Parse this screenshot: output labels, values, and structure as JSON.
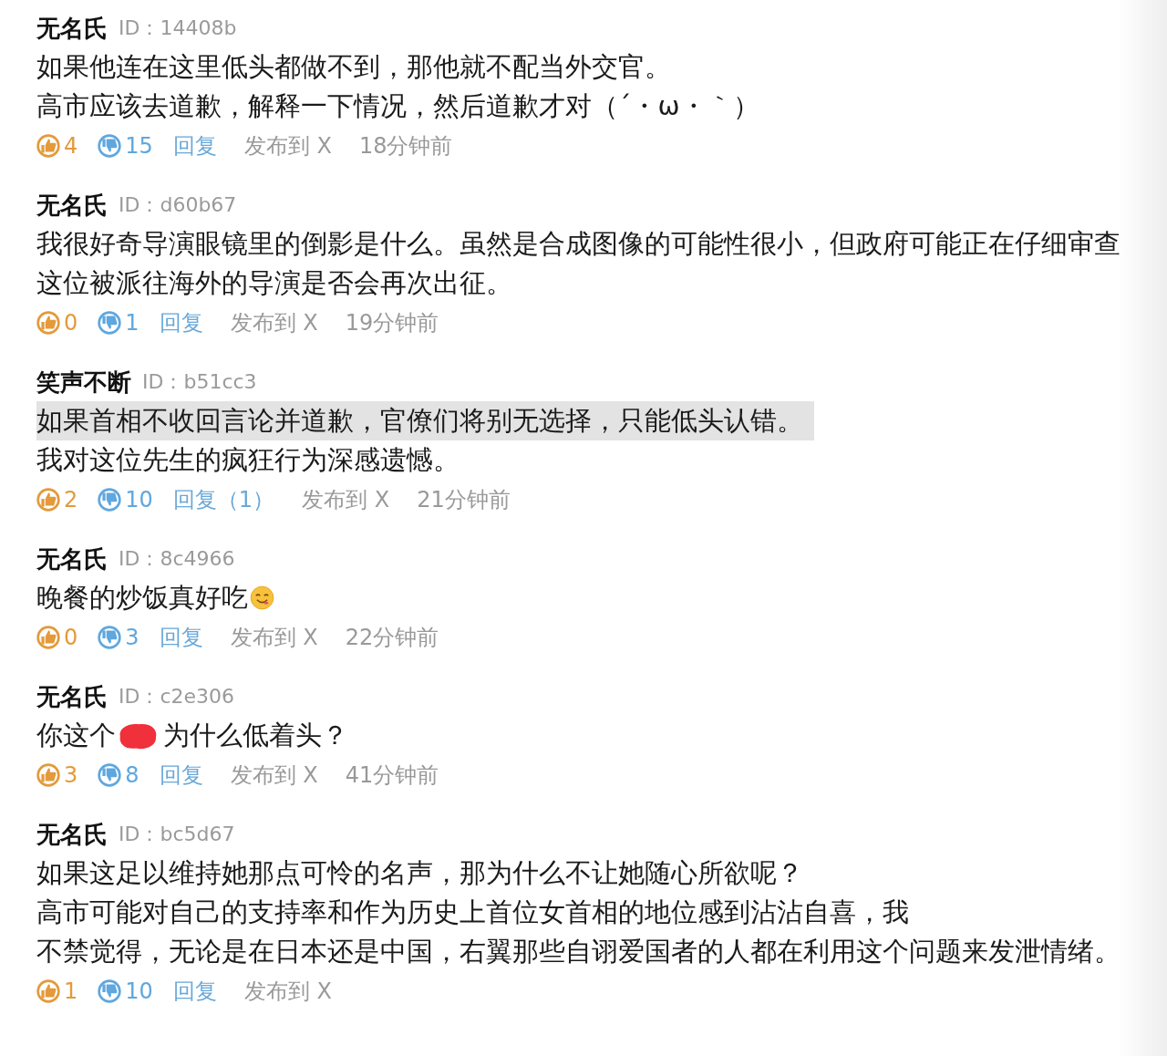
{
  "comments": [
    {
      "author": "无名氏",
      "id": "ID：14408b",
      "lines": [
        {
          "text": "如果他连在这里低头都做不到，那他就不配当外交官。",
          "highlighted": false
        },
        {
          "text": "高市应该去道歉，解释一下情况，然后道歉才对（´・ω・｀）",
          "highlighted": false
        }
      ],
      "likes": "4",
      "dislikes": "15",
      "reply": "回复",
      "share": "发布到 X",
      "time": "18分钟前"
    },
    {
      "author": "无名氏",
      "id": "ID：d60b67",
      "lines": [
        {
          "text": "我很好奇导演眼镜里的倒影是什么。虽然是合成图像的可能性很小，但政府可能正在仔细审查这位被派往海外的导演是否会再次出征。",
          "highlighted": false
        }
      ],
      "likes": "0",
      "dislikes": "1",
      "reply": "回复",
      "share": "发布到 X",
      "time": "19分钟前"
    },
    {
      "author": "笑声不断",
      "id": "ID：b51cc3",
      "lines": [
        {
          "text": "如果首相不收回言论并道歉，官僚们将别无选择，只能低头认错。",
          "highlighted": true
        },
        {
          "text": "我对这位先生的疯狂行为深感遗憾。",
          "highlighted": false
        }
      ],
      "likes": "2",
      "dislikes": "10",
      "reply": "回复（1）",
      "share": "发布到 X",
      "time": "21分钟前"
    },
    {
      "author": "无名氏",
      "id": "ID：8c4966",
      "lines": [
        {
          "text": "晚餐的炒饭真好吃",
          "highlighted": false,
          "kind": "emoji"
        }
      ],
      "likes": "0",
      "dislikes": "3",
      "reply": "回复",
      "share": "发布到 X",
      "time": "22分钟前"
    },
    {
      "author": "无名氏",
      "id": "ID：c2e306",
      "lines": [
        {
          "text": "你这个",
          "highlighted": false,
          "redacted": true,
          "after": "为什么低着头？"
        }
      ],
      "likes": "3",
      "dislikes": "8",
      "reply": "回复",
      "share": "发布到 X",
      "time": "41分钟前"
    },
    {
      "author": "无名氏",
      "id": "ID：bc5d67",
      "lines": [
        {
          "text": "如果这足以维持她那点可怜的名声，那为什么不让她随心所欲呢？",
          "highlighted": false
        },
        {
          "text": "高市可能对自己的支持率和作为历史上首位女首相的地位感到沾沾自喜，我",
          "highlighted": false
        },
        {
          "text": "不禁觉得，无论是在日本还是中国，右翼那些自诩爱国者的人都在利用这个问题来发泄情绪。",
          "highlighted": false
        }
      ],
      "likes": "1",
      "dislikes": "10",
      "reply": "回复",
      "share": "发布到 X"
    }
  ]
}
